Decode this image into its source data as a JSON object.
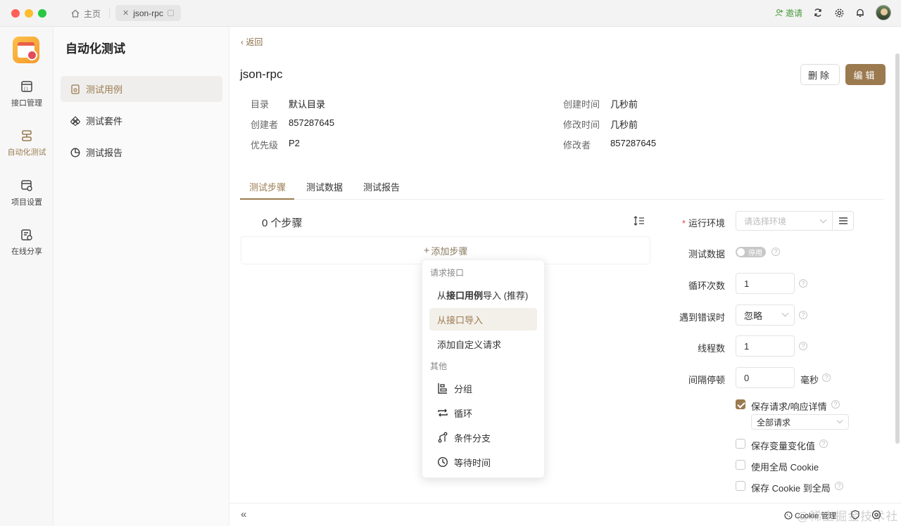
{
  "titlebar": {
    "home_tab": "主页",
    "active_tab": "json-rpc",
    "invite": "邀请"
  },
  "rail": {
    "items": [
      {
        "label": "接口管理",
        "icon": "api-icon"
      },
      {
        "label": "自动化测试",
        "icon": "automation-icon",
        "active": true
      },
      {
        "label": "项目设置",
        "icon": "project-settings-icon"
      },
      {
        "label": "在线分享",
        "icon": "share-icon"
      }
    ]
  },
  "sidebar": {
    "title": "自动化测试",
    "items": [
      {
        "label": "测试用例",
        "icon": "test-case-icon",
        "active": true
      },
      {
        "label": "测试套件",
        "icon": "test-suite-icon"
      },
      {
        "label": "测试报告",
        "icon": "test-report-icon"
      }
    ]
  },
  "main": {
    "back": "返回",
    "title": "json-rpc",
    "delete_label": "删除",
    "edit_label": "编辑",
    "meta": {
      "dir_label": "目录",
      "dir_value": "默认目录",
      "creator_label": "创建者",
      "creator_value": "857287645",
      "priority_label": "优先级",
      "priority_value": "P2",
      "created_label": "创建时间",
      "created_value": "几秒前",
      "modified_label": "修改时间",
      "modified_value": "几秒前",
      "modifier_label": "修改者",
      "modifier_value": "857287645"
    },
    "tabs": [
      "测试步骤",
      "测试数据",
      "测试报告"
    ],
    "steps_count": "0 个步骤",
    "add_step": "添加步骤"
  },
  "menu": {
    "group1": "请求接口",
    "import_case_pre": "从",
    "import_case_bold": "接口用例",
    "import_case_post": "导入 (推荐)",
    "import_api": "从接口导入",
    "custom_request": "添加自定义请求",
    "group2": "其他",
    "group": "分组",
    "loop": "循环",
    "branch": "条件分支",
    "wait": "等待时间"
  },
  "form": {
    "env_label": "运行环境",
    "env_placeholder": "请选择环境",
    "data_label": "测试数据",
    "data_toggle": "停用",
    "loop_label": "循环次数",
    "loop_value": "1",
    "error_label": "遇到错误时",
    "error_value": "忽略",
    "threads_label": "线程数",
    "threads_value": "1",
    "interval_label": "间隔停顿",
    "interval_value": "0",
    "interval_unit": "毫秒",
    "save_details": "保存请求/响应详情",
    "save_details_option": "全部请求",
    "save_vars": "保存变量变化值",
    "global_cookie": "使用全局 Cookie",
    "save_cookie": "保存 Cookie 到全局"
  },
  "bottombar": {
    "cookie": "Cookie 管理",
    "watermark": "@稀土掘金技术社区"
  },
  "colors": {
    "accent": "#9b7a50",
    "required": "#e04848",
    "invite": "#4a9b3a"
  }
}
